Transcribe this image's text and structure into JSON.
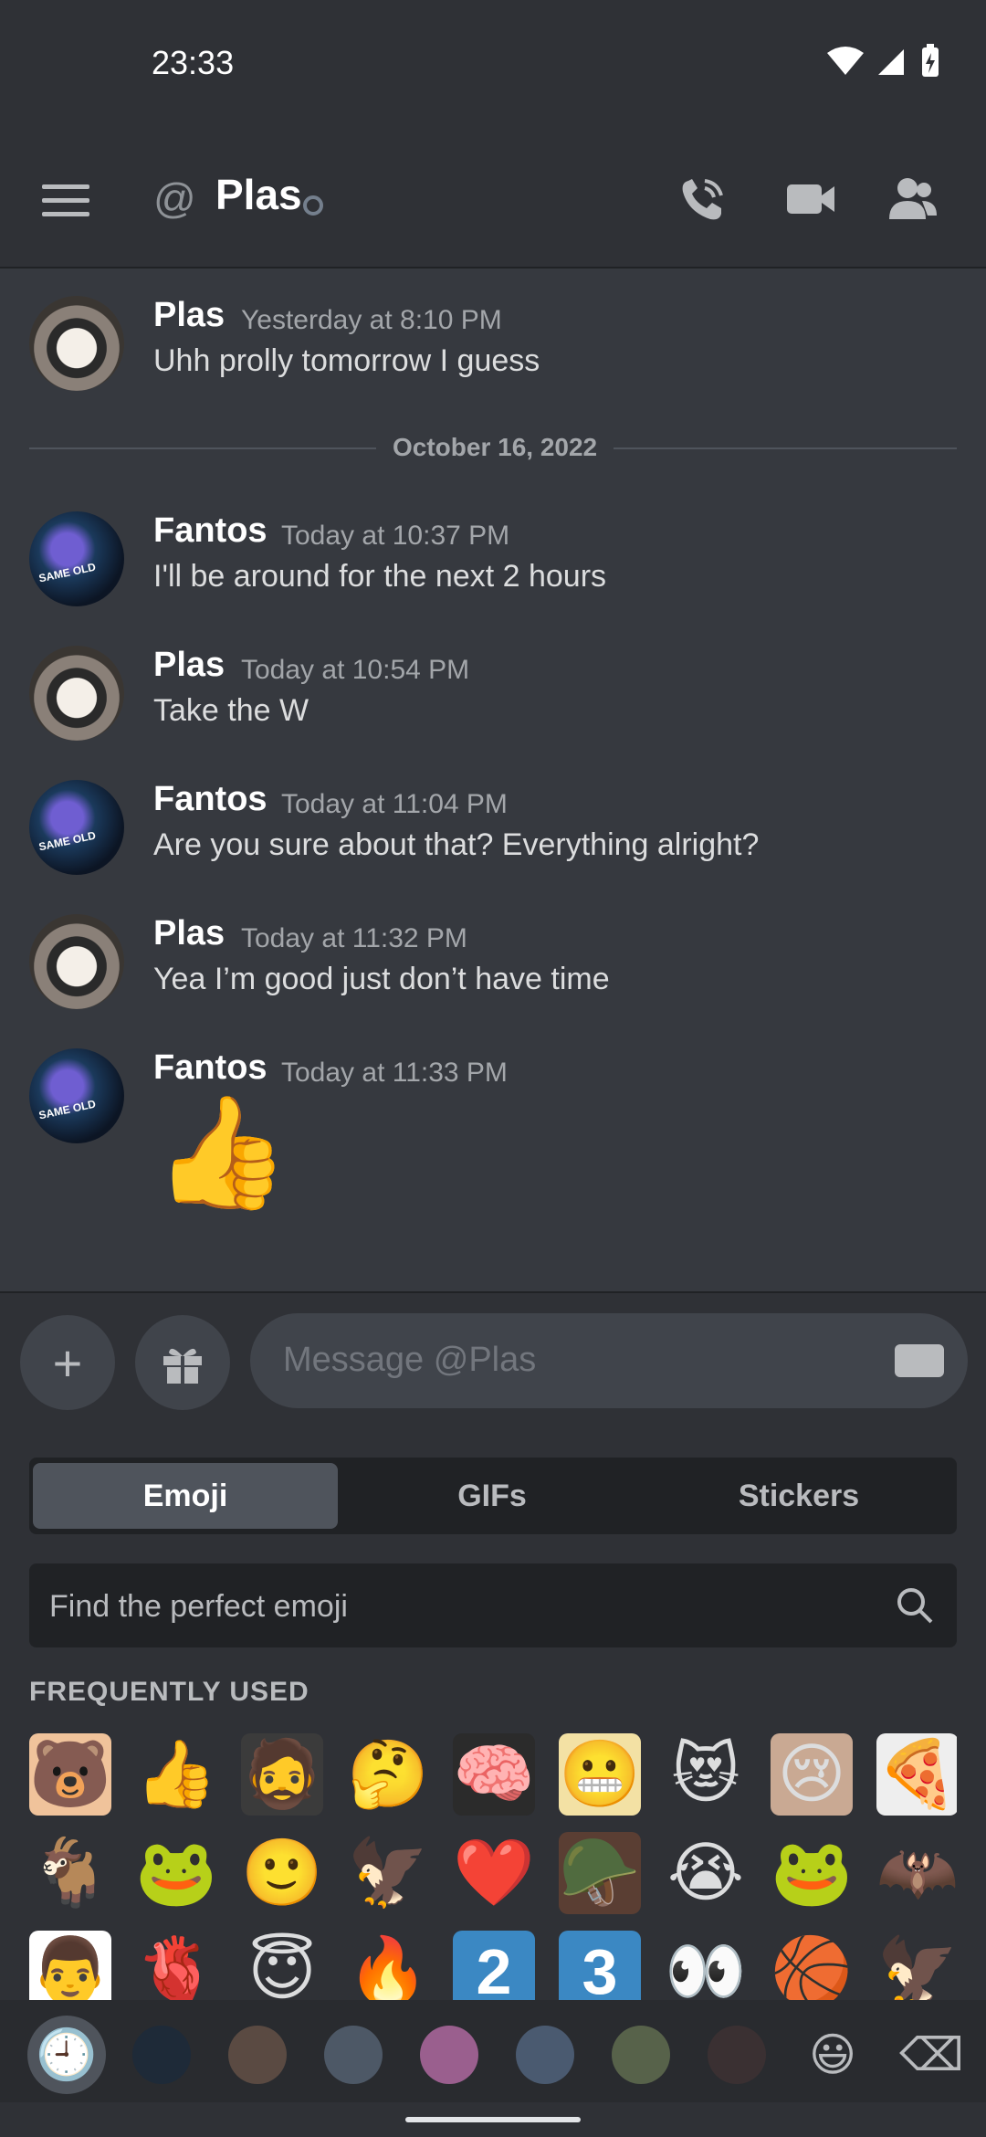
{
  "status_bar": {
    "time": "23:33"
  },
  "header": {
    "title": "Plas"
  },
  "messages": [
    {
      "author": "Plas",
      "timestamp": "Yesterday at 8:10 PM",
      "text": "Uhh prolly tomorrow I guess",
      "avatar_label": ""
    },
    {
      "author": "Fantos",
      "timestamp": "Today at 10:37 PM",
      "text": "I'll be around for the next 2 hours",
      "avatar_label": "SAME OLD"
    },
    {
      "author": "Plas",
      "timestamp": "Today at 10:54 PM",
      "text": "Take the W",
      "avatar_label": ""
    },
    {
      "author": "Fantos",
      "timestamp": "Today at 11:04 PM",
      "text": "Are you sure about that? Everything alright?",
      "avatar_label": "SAME OLD"
    },
    {
      "author": "Plas",
      "timestamp": "Today at 11:32 PM",
      "text": "Yea I’m good just don’t have time",
      "avatar_label": ""
    },
    {
      "author": "Fantos",
      "timestamp": "Today at 11:33 PM",
      "text": "👍",
      "avatar_label": "SAME OLD"
    }
  ],
  "date_divider": "October 16, 2022",
  "composer": {
    "placeholder": "Message @Plas"
  },
  "picker": {
    "tabs": [
      "Emoji",
      "GIFs",
      "Stickers"
    ],
    "active_tab": "Emoji",
    "search_placeholder": "Find the perfect emoji",
    "section_title": "FREQUENTLY USED",
    "emojis": [
      {
        "name": "bear-love-emoji",
        "glyph": "🐻",
        "bg": "#f0c39b"
      },
      {
        "name": "thumbs-up-emoji",
        "glyph": "👍",
        "bg": "transparent"
      },
      {
        "name": "bearded-man-emoji",
        "glyph": "🧔",
        "bg": "#3b3b3b"
      },
      {
        "name": "thinking-emoji",
        "glyph": "🤔",
        "bg": "transparent"
      },
      {
        "name": "smart-guy-emoji",
        "glyph": "🧠",
        "bg": "#2b2b2b"
      },
      {
        "name": "blonde-cartoon-emoji",
        "glyph": "😬",
        "bg": "#f3e1a4"
      },
      {
        "name": "cat-heart-emoji",
        "glyph": "😻",
        "bg": "transparent"
      },
      {
        "name": "crying-face-photo-emoji",
        "glyph": "😢",
        "bg": "#c9a993"
      },
      {
        "name": "pizza-hat-kid-emoji",
        "glyph": "🍕",
        "bg": "#eee"
      },
      {
        "name": "goat-emoji",
        "glyph": "🐐",
        "bg": "transparent"
      },
      {
        "name": "pepe-emoji",
        "glyph": "🐸",
        "bg": "transparent"
      },
      {
        "name": "orange-smile-emoji",
        "glyph": "🙂",
        "bg": "transparent"
      },
      {
        "name": "phoenix-emoji",
        "glyph": "🦅",
        "bg": "transparent"
      },
      {
        "name": "heart-girl-emoji",
        "glyph": "❤️",
        "bg": "transparent"
      },
      {
        "name": "soldier-emoji",
        "glyph": "🪖",
        "bg": "#5a3e33"
      },
      {
        "name": "loudly-crying-emoji",
        "glyph": "😭",
        "bg": "transparent"
      },
      {
        "name": "pepe-cross-emoji",
        "glyph": "🐸",
        "bg": "transparent"
      },
      {
        "name": "bat-emoji",
        "glyph": "🦇",
        "bg": "transparent"
      },
      {
        "name": "anime-man-emoji",
        "glyph": "👨",
        "bg": "#ffffff"
      },
      {
        "name": "anatomical-heart-emoji",
        "glyph": "🫀",
        "bg": "transparent"
      },
      {
        "name": "angel-face-emoji",
        "glyph": "😇",
        "bg": "transparent"
      },
      {
        "name": "fire-emoji",
        "glyph": "🔥",
        "bg": "transparent"
      },
      {
        "name": "keycap-two-emoji",
        "glyph": "2",
        "bg": "#3b88c3"
      },
      {
        "name": "keycap-three-emoji",
        "glyph": "3",
        "bg": "#3b88c3"
      },
      {
        "name": "eyes-emoji",
        "glyph": "👀",
        "bg": "transparent"
      },
      {
        "name": "basketball-emoji",
        "glyph": "🏀",
        "bg": "transparent"
      },
      {
        "name": "time-bird-emoji",
        "glyph": "🦅",
        "bg": "transparent"
      }
    ],
    "categories": [
      {
        "name": "recent-category-icon",
        "glyph": "🕘"
      },
      {
        "name": "server-category-1",
        "glyph": ""
      },
      {
        "name": "server-category-2",
        "glyph": ""
      },
      {
        "name": "server-category-3",
        "glyph": ""
      },
      {
        "name": "server-category-4",
        "glyph": ""
      },
      {
        "name": "server-category-5",
        "glyph": ""
      },
      {
        "name": "server-category-6",
        "glyph": ""
      },
      {
        "name": "server-category-7",
        "glyph": ""
      },
      {
        "name": "smiley-category-icon",
        "glyph": "😃"
      },
      {
        "name": "backspace-icon",
        "glyph": "⌫"
      }
    ]
  },
  "colors": {
    "background": "#36393f",
    "header": "#2f3136",
    "input": "#40444b",
    "keycap": "#3b88c3"
  }
}
